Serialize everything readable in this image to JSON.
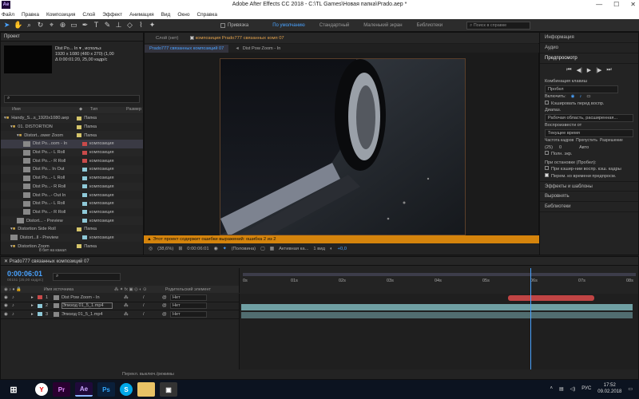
{
  "app": {
    "title": "Adobe After Effects CC 2018 - C:\\TL Games\\Новая папка\\Prado.aep *",
    "logo": "Ae"
  },
  "menu": [
    "Файл",
    "Правка",
    "Композиция",
    "Слой",
    "Эффект",
    "Анимация",
    "Вид",
    "Окно",
    "Справка"
  ],
  "toolbar": {
    "snap_label": "Привязка",
    "workspaces": [
      "По умолчанию",
      "Стандартный",
      "Маленький экран",
      "Библиотеки"
    ],
    "search_placeholder": "Поиск в справке"
  },
  "project": {
    "tab": "Проект",
    "item_name": "Dist Po... In ▾ , использ",
    "item_info1": "1920 x 1080 (480 x 270) (1,00",
    "item_info2": "Δ 0:00:01:20, 25,00 кадр/с",
    "search_placeholder": "",
    "columns": {
      "name": "Имя",
      "type": "Тип",
      "size": "Размер"
    },
    "rows": [
      {
        "name": "Handy_S...s_1920x1080.aep",
        "type": "Папка",
        "color": "#d4c46a",
        "indent": 0,
        "thumb": false
      },
      {
        "name": "01. DISTORTION",
        "type": "Папка",
        "color": "#d4c46a",
        "indent": 1,
        "thumb": false
      },
      {
        "name": "Distort...ower Zoom",
        "type": "Папка",
        "color": "#d4c46a",
        "indent": 2,
        "thumb": false
      },
      {
        "name": "Dist Po...oom - In",
        "type": "композиция",
        "color": "#c94a4a",
        "indent": 3,
        "thumb": true,
        "sel": true
      },
      {
        "name": "Dist Po...- L Roll",
        "type": "композиция",
        "color": "#c94a4a",
        "indent": 3,
        "thumb": true
      },
      {
        "name": "Dist Po...- R Roll",
        "type": "композиция",
        "color": "#c94a4a",
        "indent": 3,
        "thumb": true
      },
      {
        "name": "Dist Po... In Out",
        "type": "композиция",
        "color": "#8ec9d8",
        "indent": 3,
        "thumb": true
      },
      {
        "name": "Dist Po...- L Roll",
        "type": "композиция",
        "color": "#8ec9d8",
        "indent": 3,
        "thumb": true
      },
      {
        "name": "Dist Po...- R Roll",
        "type": "композиция",
        "color": "#8ec9d8",
        "indent": 3,
        "thumb": true
      },
      {
        "name": "Dist Po...- Out In",
        "type": "композиция",
        "color": "#8ec9d8",
        "indent": 3,
        "thumb": true
      },
      {
        "name": "Dist Po...- L Roll",
        "type": "композиция",
        "color": "#8ec9d8",
        "indent": 3,
        "thumb": true
      },
      {
        "name": "Dist Po...- R Roll",
        "type": "композиция",
        "color": "#8ec9d8",
        "indent": 3,
        "thumb": true
      },
      {
        "name": "Distort... - Preview",
        "type": "композиция",
        "color": "#8ec9d8",
        "indent": 2,
        "thumb": true
      },
      {
        "name": "Distortion Side Roll",
        "type": "Папка",
        "color": "#d4c46a",
        "indent": 1,
        "thumb": false
      },
      {
        "name": "Distort...ll - Preview",
        "type": "композиция",
        "color": "#8ec9d8",
        "indent": 1,
        "thumb": true
      },
      {
        "name": "Distortion Zoom",
        "type": "Папка",
        "color": "#d4c46a",
        "indent": 1,
        "thumb": false
      }
    ],
    "bpc": "8 бит на канал"
  },
  "viewer": {
    "tabs": [
      "Слой (нет)",
      "композиция Prado777 связанных комп 07"
    ],
    "subtab_active": "Prado777 связанных композиций 07",
    "subtab_other": "Dist Pow Zoom - In",
    "warning": "Этот проект содержит ошибки выражений: ошибка 2 из 2",
    "zoom": "(38,6%)",
    "timecode": "0:00:06:01",
    "resolution": "(Половина)",
    "camera": "Активная ка...",
    "views": "1 вид",
    "offset": "+0,0"
  },
  "right_panel": {
    "items": [
      "Информация",
      "Аудио"
    ],
    "preview": {
      "title": "Предпросмотр",
      "shortcut_label": "Комбинация клавиш",
      "shortcut_value": "Пробел",
      "include_label": "Включить:",
      "cache_label": "Кэшировать перед воспр.",
      "range_label": "Диапаз.",
      "range_value": "Рабочая область, расширенная...",
      "play_from_label": "Воспроизвести от",
      "play_from_value": "Текущее время",
      "fps_label": "Частота кадров",
      "skip_label": "Пропустить",
      "res_label": "Разрешение",
      "fps_value": "(25)",
      "skip_value": "0",
      "res_value": "Авто",
      "fullscreen": "Полн. экр.",
      "on_stop": "При остановке (Пробел):",
      "opt1": "При кэшир-нии воспр. кэш. кадры",
      "opt2": "Перем. ко времени предпросм."
    },
    "bottom": [
      "Эффекты и шаблоны",
      "Выровнять",
      "Библиотеки"
    ]
  },
  "timeline": {
    "tab": "Prado777 связанных композиций 07",
    "timecode": "0:00:06:01",
    "timecode_sub": "00151 (25,00 кадр/с)",
    "col_source": "Имя источника",
    "col_parent": "Родительский элемент",
    "layers": [
      {
        "num": "1",
        "name": "Dist Pow Zoom - In",
        "color": "#c94a4a",
        "parent": "Нет"
      },
      {
        "num": "2",
        "name": "Эпизод 01_5_1.mp4",
        "color": "#8ec9d8",
        "parent": "Нет"
      },
      {
        "num": "3",
        "name": "Эпизод 01_5_1.mp4",
        "color": "#8ec9d8",
        "parent": "Нет"
      }
    ],
    "ruler": [
      "0s",
      "01s",
      "02s",
      "03s",
      "04s",
      "05s",
      "06s",
      "07s",
      "08s"
    ],
    "bottom_label": "Перекл. выключ./режимы"
  },
  "taskbar": {
    "apps": [
      "Y",
      "Pr",
      "Ae",
      "Ps",
      "S",
      "",
      "▣"
    ],
    "lang": "РУС",
    "time": "17:52",
    "date": "09.02.2018"
  }
}
